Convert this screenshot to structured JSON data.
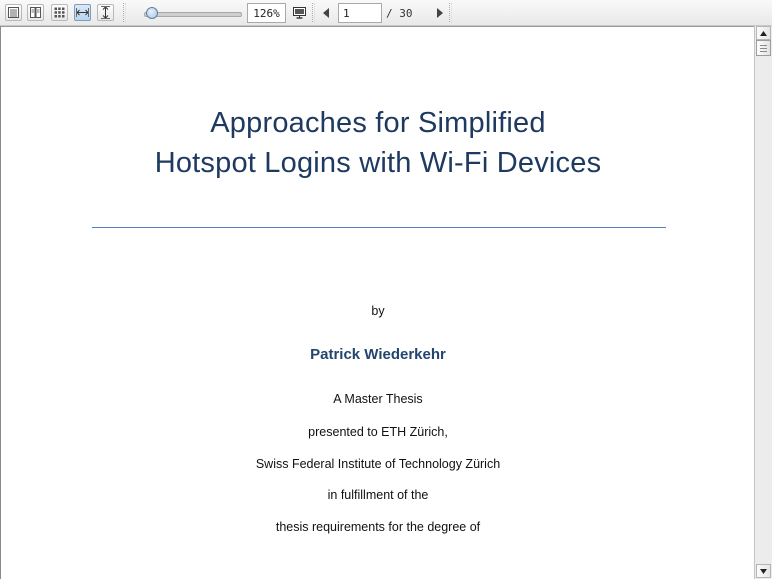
{
  "toolbar": {
    "view_buttons": [
      {
        "name": "single-page-view-icon"
      },
      {
        "name": "two-page-view-icon"
      },
      {
        "name": "thumbnail-grid-icon"
      },
      {
        "name": "fit-width-icon"
      },
      {
        "name": "fit-height-icon"
      }
    ],
    "zoom_level": 0.126,
    "zoom_label": "126%",
    "page_current": "1",
    "page_total": "/ 30"
  },
  "document": {
    "title_line1": "Approaches for Simplified",
    "title_line2": "Hotspot Logins with Wi-Fi Devices",
    "by": "by",
    "author": "Patrick Wiederkehr",
    "lines": [
      "A Master Thesis",
      "presented to ETH Zürich,",
      "Swiss Federal Institute of Technology Zürich",
      "in fulfillment of the",
      "thesis requirements for the degree of"
    ]
  },
  "colors": {
    "title": "#1f3a60",
    "author": "#23456e",
    "rule": "#4f81bd"
  }
}
